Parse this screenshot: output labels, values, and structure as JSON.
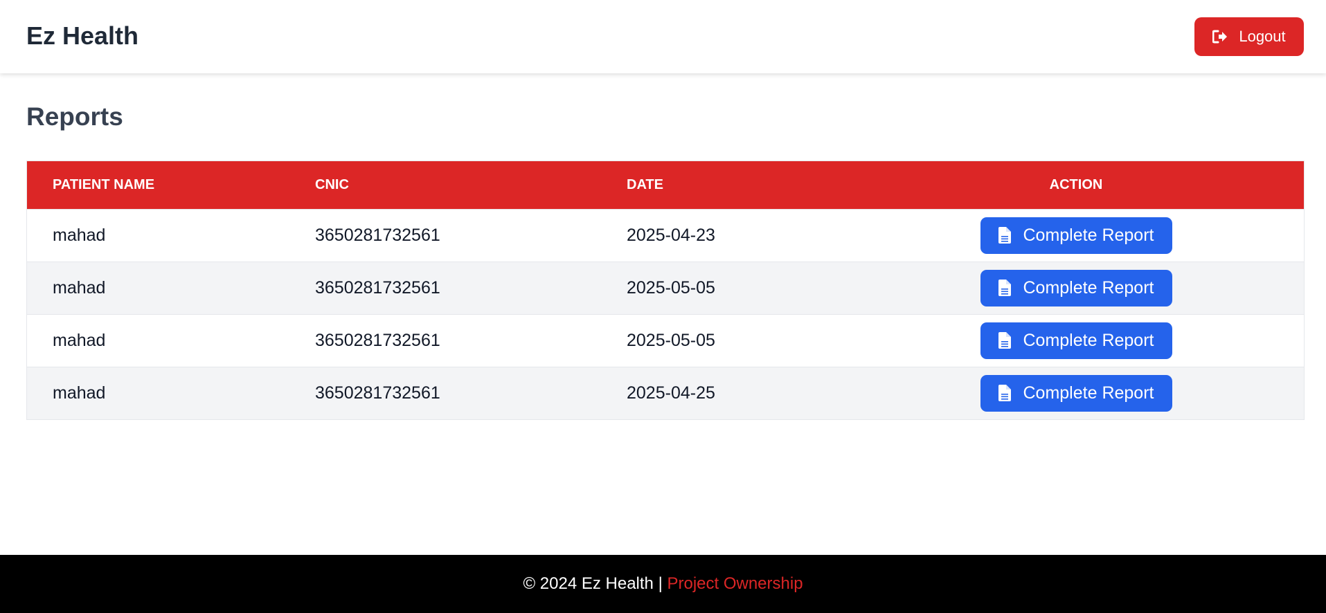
{
  "header": {
    "brand": "Ez Health",
    "logout_label": "Logout",
    "logout_icon": "sign-out-icon"
  },
  "page": {
    "title": "Reports"
  },
  "table": {
    "columns": [
      "PATIENT NAME",
      "CNIC",
      "DATE",
      "ACTION"
    ],
    "rows": [
      {
        "name": "mahad",
        "cnic": "3650281732561",
        "date": "2025-04-23",
        "action": "Complete Report"
      },
      {
        "name": "mahad",
        "cnic": "3650281732561",
        "date": "2025-05-05",
        "action": "Complete Report"
      },
      {
        "name": "mahad",
        "cnic": "3650281732561",
        "date": "2025-05-05",
        "action": "Complete Report"
      },
      {
        "name": "mahad",
        "cnic": "3650281732561",
        "date": "2025-04-25",
        "action": "Complete Report"
      }
    ],
    "action_icon": "file-document-icon"
  },
  "footer": {
    "copyright": "© 2024 Ez Health | ",
    "link_label": "Project Ownership"
  },
  "colors": {
    "primary_red": "#dc2626",
    "primary_blue": "#2563eb",
    "footer_bg": "#000000",
    "zebra_row": "#f3f4f6"
  }
}
